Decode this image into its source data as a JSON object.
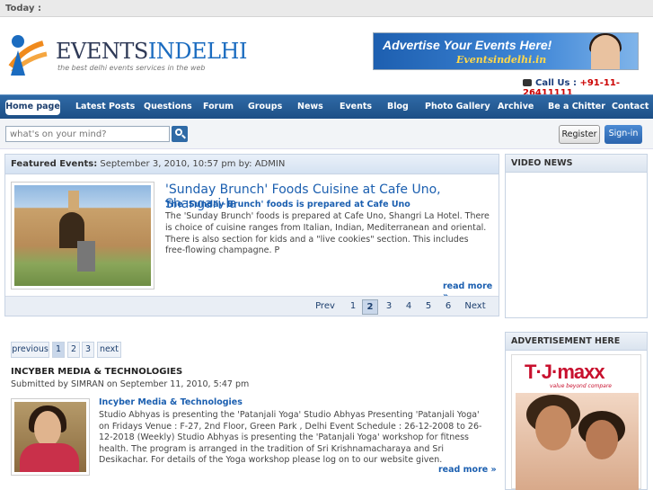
{
  "topbar": {
    "today_label": "Today :"
  },
  "logo": {
    "name_prefix": "EVENTS",
    "name_highlight": "INDELHI",
    "tagline": "the best delhi events services in the web"
  },
  "banner": {
    "headline": "Advertise Your Events Here!",
    "site": "Eventsindelhi.in"
  },
  "contact": {
    "label": "Call Us :",
    "number": "+91-11-26411111"
  },
  "nav": {
    "items": [
      "Home page",
      "Latest Posts",
      "Questions",
      "Forum",
      "Groups",
      "News",
      "Events",
      "Blog",
      "Photo Gallery",
      "Archive",
      "Be a Chitter",
      "Contact"
    ]
  },
  "search": {
    "placeholder": "what's on your mind?",
    "register_label": "Register",
    "signin_label": "Sign-in"
  },
  "featured": {
    "label": "Featured Events:",
    "meta": "September 3, 2010, 10:57 pm by: ADMIN",
    "title": "'Sunday Brunch' Foods Cuisine at Cafe Uno, Shangari-la",
    "subtitle": "The 'Sunday Brunch' foods is prepared at Cafe Uno",
    "body": "The 'Sunday Brunch' foods is prepared at Cafe Uno, Shangri La Hotel. There is choice of cuisine ranges from Italian, Indian, Mediterranean and oriental. There is also section for kids and a \"live cookies\" section. This includes free-flowing champagne. P",
    "read_more": "read more »",
    "pager": {
      "prev": "Prev",
      "pages": [
        "1",
        "2",
        "3",
        "4",
        "5",
        "6"
      ],
      "current": "2",
      "next": "Next"
    }
  },
  "list_pager": {
    "previous": "previous",
    "pages": [
      "1",
      "2",
      "3"
    ],
    "current": "1",
    "next": "next"
  },
  "post": {
    "title": "INCYBER MEDIA & TECHNOLOGIES",
    "submitted": "Submitted by SIMRAN on September 11, 2010, 5:47 pm",
    "link": "Incyber Media & Technologies",
    "body": "Studio Abhyas is presenting the 'Patanjali Yoga' Studio Abhyas Presenting 'Patanjali Yoga' on Fridays Venue : F-27, 2nd Floor, Green Park , Delhi Event Schedule : 26-12-2008 to 26-12-2018 (Weekly) Studio Abhyas is presenting the 'Patanjali Yoga' workshop for fitness health. The program is arranged in the tradition of Sri Krishnamacharaya and Sri Desikachar. For details of the Yoga workshop please log on to our website given.",
    "read_more": "read more »"
  },
  "sidebar": {
    "video_title": "VIDEO NEWS",
    "ad_title": "ADVERTISEMENT HERE",
    "ad_brand": "T·J·maxx",
    "ad_slogan": "value beyond compare"
  },
  "colors": {
    "nav_blue": "#1d4f86",
    "link_blue": "#1b5fb0",
    "brand_red": "#c8102e"
  }
}
